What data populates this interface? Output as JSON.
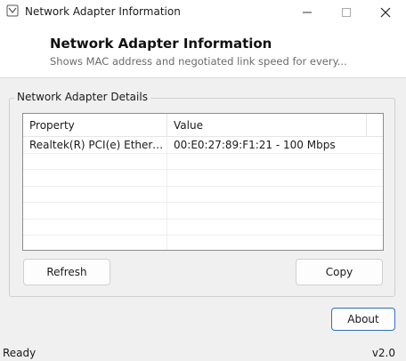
{
  "window": {
    "title": "Network Adapter Information",
    "icon": "app-window-icon",
    "controls": [
      "minimize-icon",
      "maximize-icon",
      "close-icon"
    ]
  },
  "header": {
    "title": "Network Adapter Information",
    "subtitle": "Shows MAC address and negotiated link speed for every..."
  },
  "group": {
    "label": "Network Adapter Details"
  },
  "listview": {
    "columns": [
      "Property",
      "Value"
    ],
    "rows": [
      {
        "property": "Realtek(R) PCI(e) Ethernet ...",
        "value": "00:E0:27:89:F1:21 - 100 Mbps"
      },
      {
        "property": "",
        "value": ""
      },
      {
        "property": "",
        "value": ""
      },
      {
        "property": "",
        "value": ""
      },
      {
        "property": "",
        "value": ""
      },
      {
        "property": "",
        "value": ""
      },
      {
        "property": "",
        "value": ""
      }
    ]
  },
  "buttons": {
    "refresh": "Refresh",
    "copy": "Copy",
    "about": "About"
  },
  "statusbar": {
    "status": "Ready",
    "version": "v2.0"
  },
  "colors": {
    "accent_border": "#2f6fbf",
    "window_bg": "#f0f0f0",
    "panel_bg": "#ffffff"
  }
}
